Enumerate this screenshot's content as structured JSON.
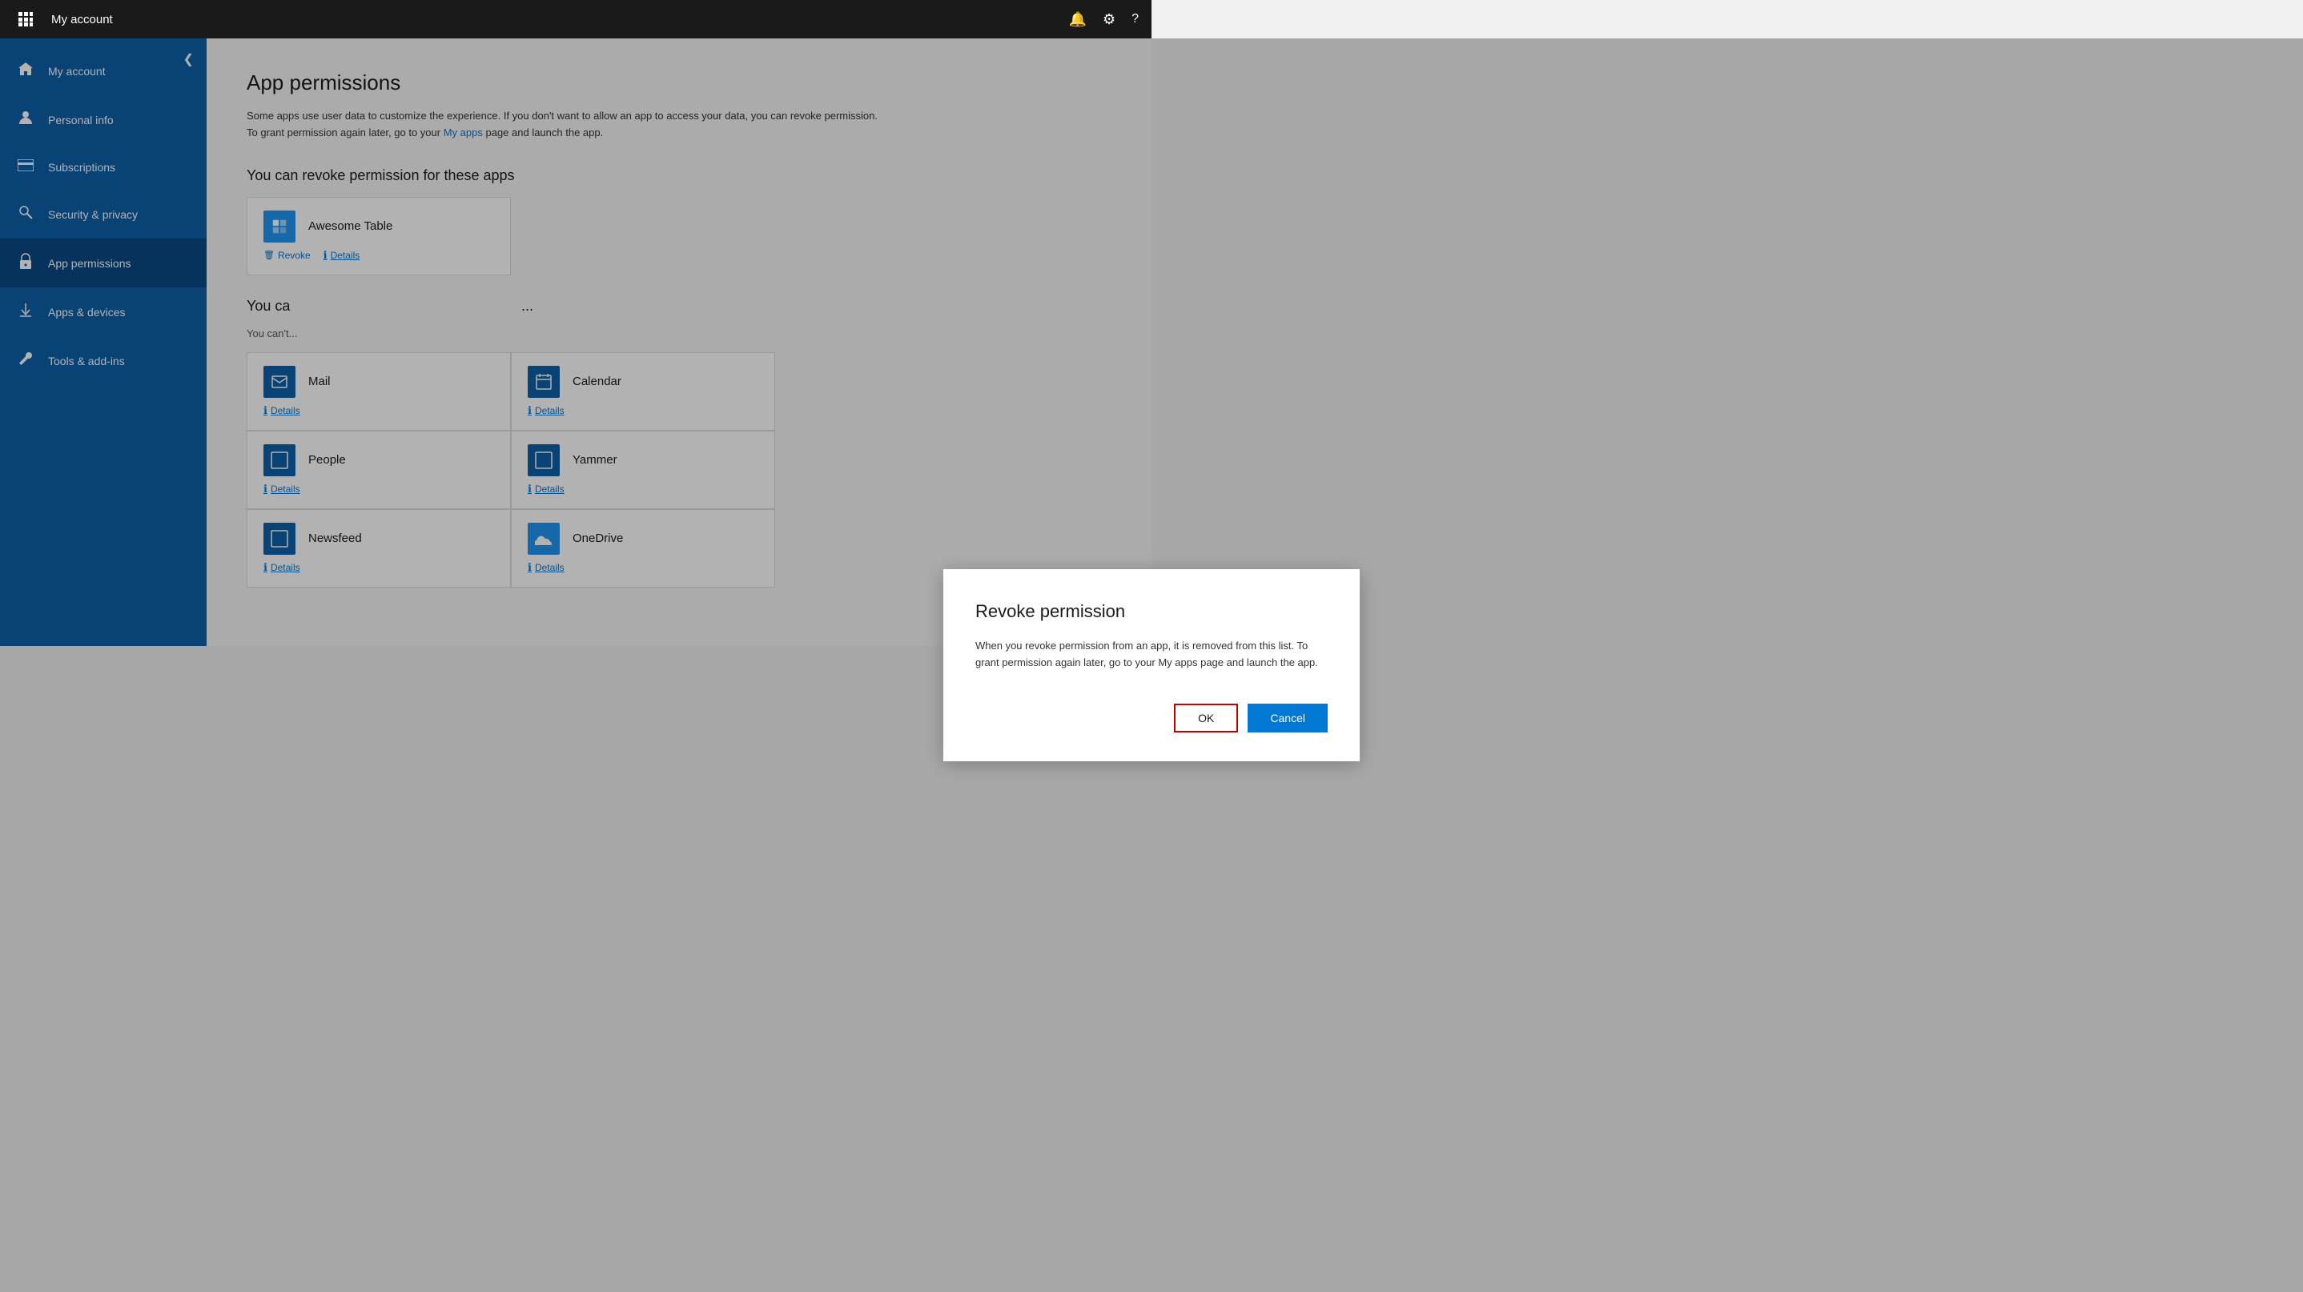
{
  "topbar": {
    "title": "My account",
    "grid_icon": "⊞",
    "bell_icon": "🔔",
    "gear_icon": "⚙",
    "help_icon": "?"
  },
  "sidebar": {
    "collapse_label": "❮",
    "items": [
      {
        "id": "my-account",
        "label": "My account",
        "icon": "🏠"
      },
      {
        "id": "personal-info",
        "label": "Personal info",
        "icon": "👤"
      },
      {
        "id": "subscriptions",
        "label": "Subscriptions",
        "icon": "💳"
      },
      {
        "id": "security-privacy",
        "label": "Security & privacy",
        "icon": "🔍"
      },
      {
        "id": "app-permissions",
        "label": "App permissions",
        "icon": "🔒",
        "active": true
      },
      {
        "id": "apps-devices",
        "label": "Apps & devices",
        "icon": "⬇"
      },
      {
        "id": "tools-addins",
        "label": "Tools & add-ins",
        "icon": "🔧"
      }
    ]
  },
  "content": {
    "page_title": "App permissions",
    "page_desc": "Some apps use user data to customize the experience. If you don't want to allow an app to access your data, you can revoke permission. To grant permission again later, go to your",
    "my_apps_link": "My apps",
    "page_desc_end": "page and launch the app.",
    "revokable_section_title": "You can revoke permission for these apps",
    "revokable_apps": [
      {
        "name": "Awesome Table",
        "icon_char": "🗂",
        "revoke_label": "Revoke",
        "details_label": "Details"
      }
    ],
    "cannot_revoke_section_title": "You can't revoke permission for these apps",
    "cannot_revoke_desc": "You can't",
    "cannot_revoke_apps": [
      {
        "name": "Mail",
        "icon_char": "☐",
        "details_label": "Details"
      },
      {
        "name": "Calendar",
        "icon_char": "☐",
        "details_label": "Details"
      },
      {
        "name": "People",
        "icon_char": "☐",
        "details_label": "Details"
      },
      {
        "name": "Yammer",
        "icon_char": "☐",
        "details_label": "Details"
      },
      {
        "name": "Newsfeed",
        "icon_char": "☐",
        "details_label": "Details"
      },
      {
        "name": "OneDrive",
        "icon_char": "☁",
        "details_label": "Details"
      }
    ]
  },
  "modal": {
    "title": "Revoke permission",
    "body": "When you revoke permission from an app, it is removed from this list. To grant permission again later, go to your My apps page and launch the app.",
    "ok_label": "OK",
    "cancel_label": "Cancel"
  }
}
